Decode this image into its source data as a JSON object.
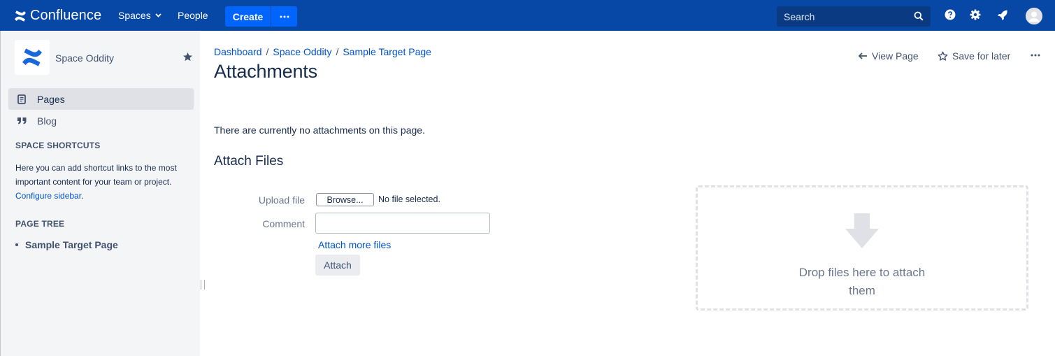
{
  "topbar": {
    "logo_text": "Confluence",
    "nav": {
      "spaces": "Spaces",
      "people": "People"
    },
    "create_label": "Create",
    "search_placeholder": "Search",
    "bg_color": "#0747a6",
    "accent_color": "#0065ff",
    "icons": [
      "confluence-logo-icon",
      "chevron-down-icon",
      "more-horizontal-icon",
      "search-icon",
      "help-icon",
      "gear-icon",
      "notifications-rocket-icon",
      "avatar-icon"
    ]
  },
  "sidebar": {
    "space_name": "Space Oddity",
    "items": [
      {
        "label": "Pages",
        "icon": "pages-icon",
        "active": true
      },
      {
        "label": "Blog",
        "icon": "quote-icon",
        "active": false
      }
    ],
    "shortcuts_heading": "SPACE SHORTCUTS",
    "shortcuts_text": "Here you can add shortcut links to the most important content for your team or project.",
    "configure_link": "Configure sidebar",
    "page_tree_heading": "PAGE TREE",
    "tree": [
      {
        "label": "Sample Target Page"
      }
    ]
  },
  "main": {
    "breadcrumb": [
      "Dashboard",
      "Space Oddity",
      "Sample Target Page"
    ],
    "breadcrumb_sep": "/",
    "title": "Attachments",
    "actions": {
      "view_page": "View Page",
      "save_for_later": "Save for later"
    },
    "no_attachments": "There are currently no attachments on this page.",
    "attach_heading": "Attach Files",
    "form": {
      "upload_label": "Upload file",
      "browse_label": "Browse...",
      "no_file": "No file selected.",
      "comment_label": "Comment",
      "comment_value": "",
      "attach_more": "Attach more files",
      "attach_button": "Attach"
    },
    "dropzone_text": "Drop files here to attach them"
  }
}
